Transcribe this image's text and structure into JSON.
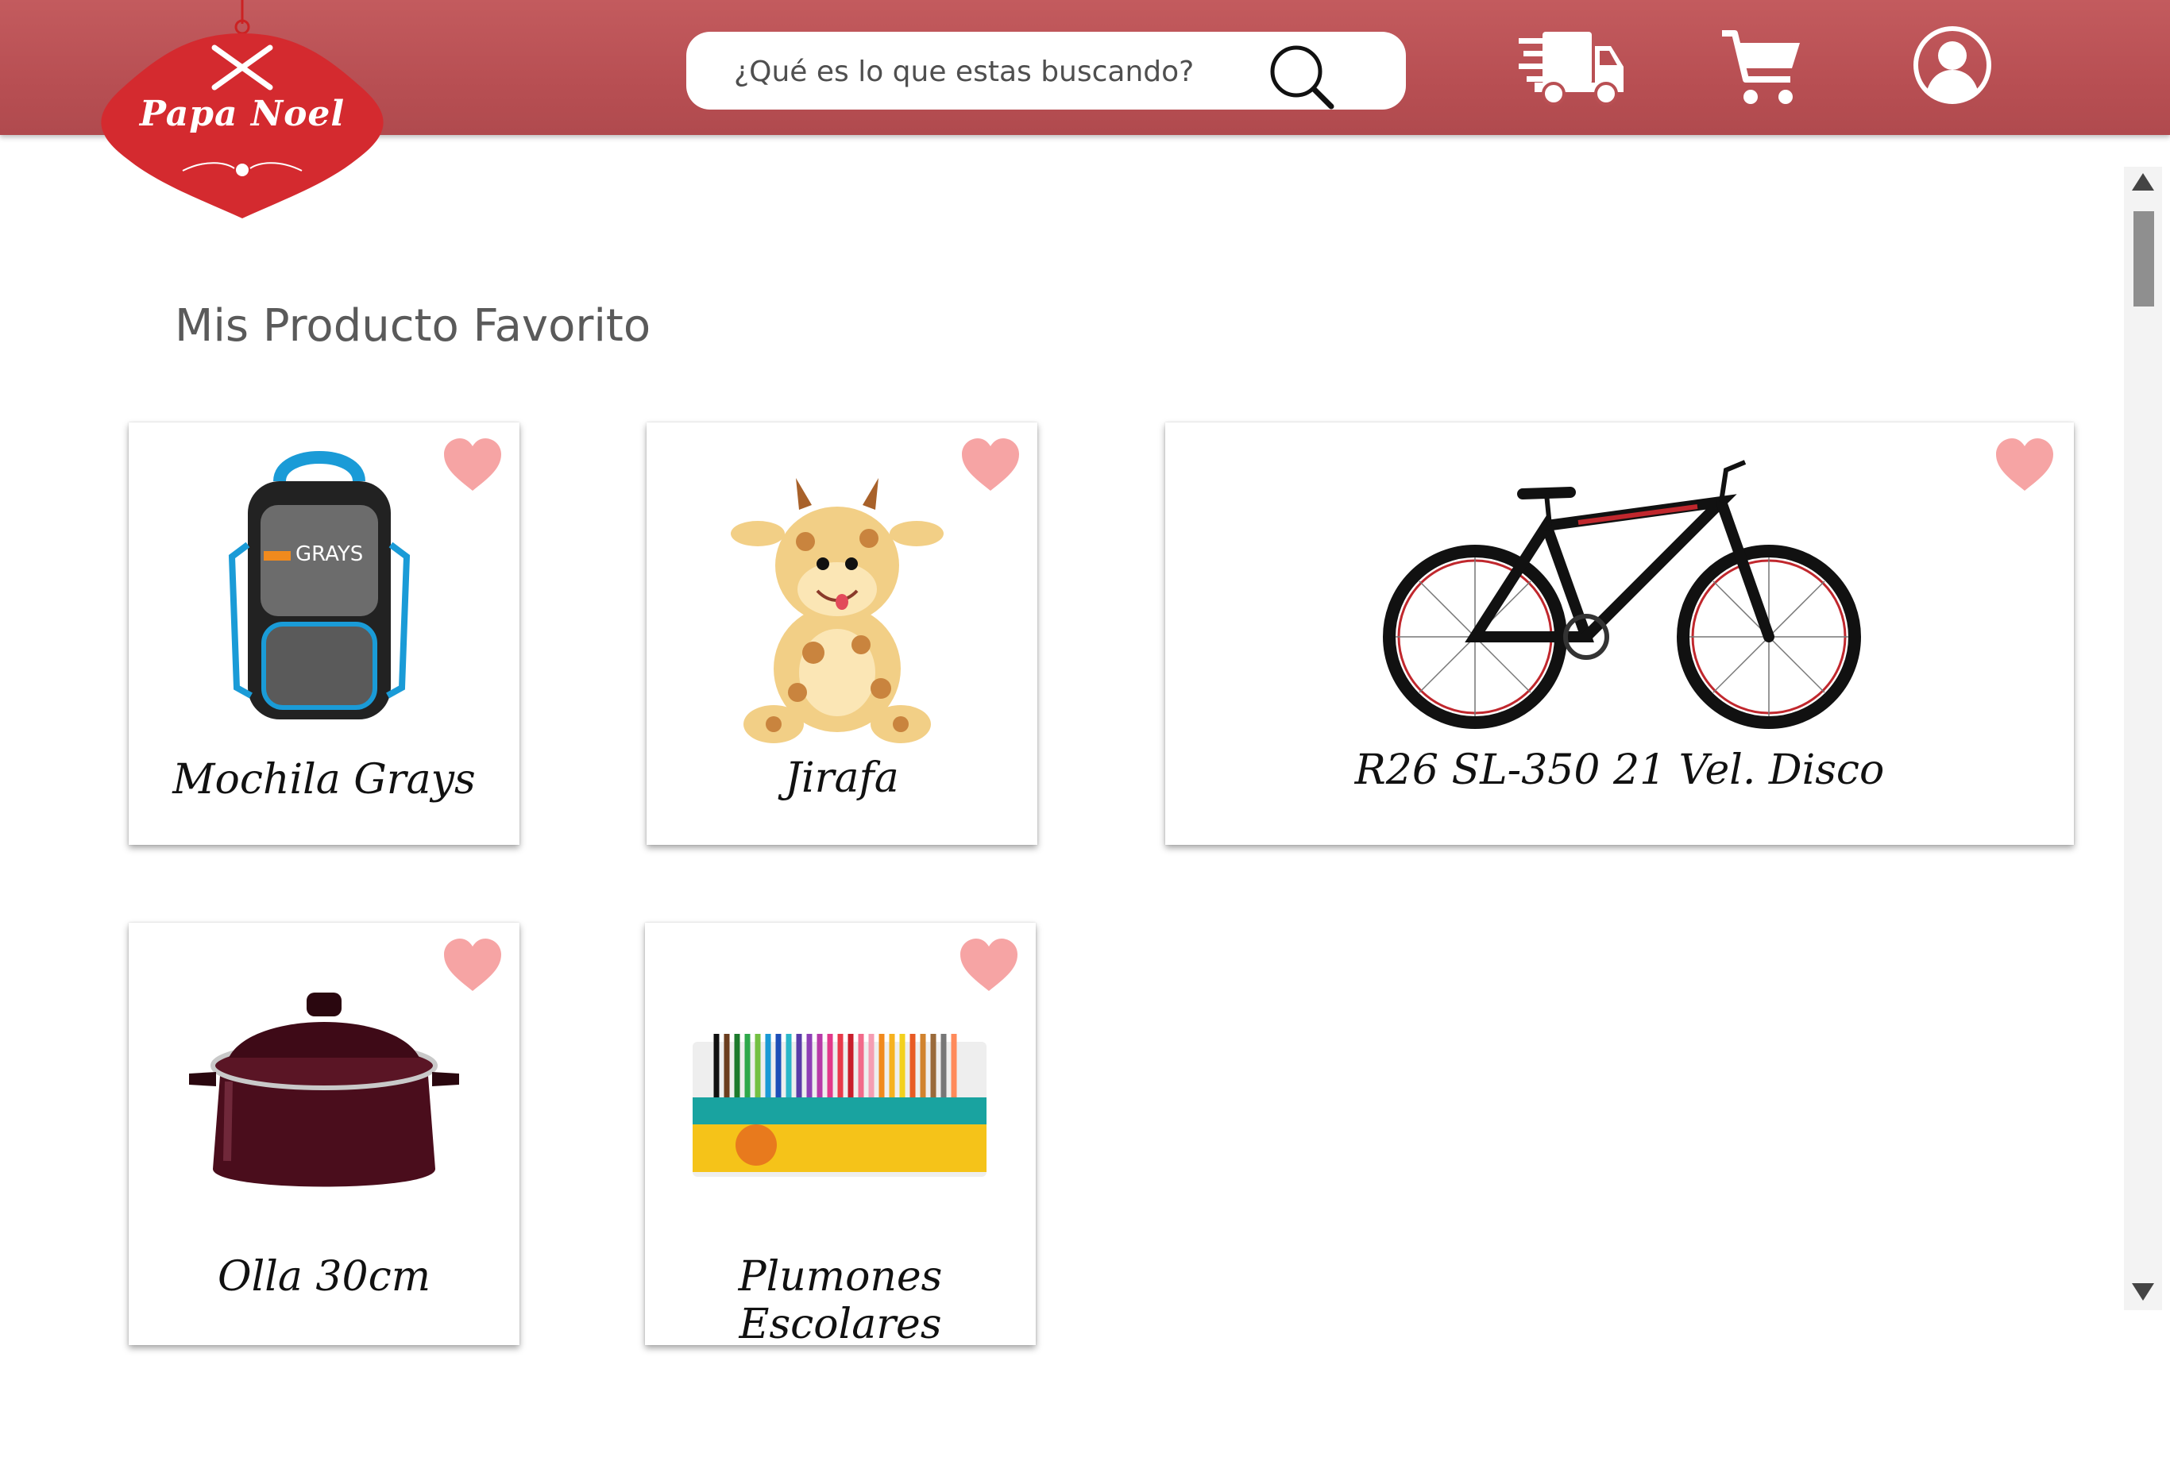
{
  "brand": {
    "name": "Papa Noel",
    "color": "#d42a2f"
  },
  "header": {
    "background_color": "#b94f53",
    "search": {
      "placeholder": "¿Qué es lo que estas buscando?"
    },
    "icons": [
      "search-icon",
      "delivery-truck-icon",
      "shopping-cart-icon",
      "user-account-icon"
    ]
  },
  "main": {
    "title": "Mis Producto Favorito",
    "products": [
      {
        "name": "Mochila Grays",
        "favorite": true
      },
      {
        "name": "Jirafa",
        "favorite": true
      },
      {
        "name": "R26 SL-350 21 Vel. Disco",
        "favorite": true
      },
      {
        "name": "Olla 30cm",
        "favorite": true
      },
      {
        "name": "Plumones Escolares",
        "favorite": true
      }
    ]
  },
  "colors": {
    "heart": "#f6a4a4",
    "text": "#111111",
    "title": "#5a5a5a"
  }
}
